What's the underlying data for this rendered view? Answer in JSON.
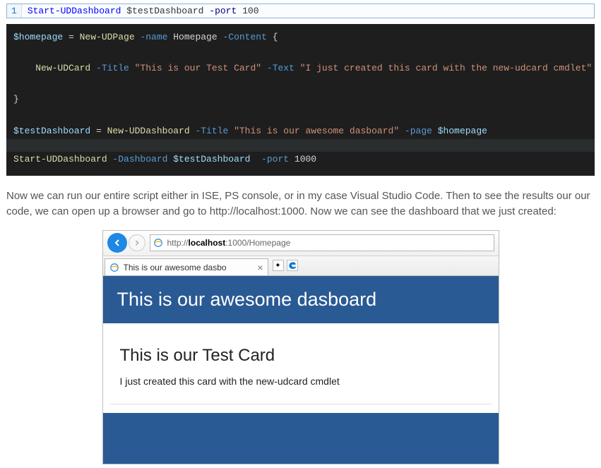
{
  "single_line": {
    "ln": "1",
    "cmd": "Start-UDDashboard",
    "var": "$testDashboard",
    "param": "-port",
    "num": "100"
  },
  "dark": {
    "l1": {
      "var": "$homepage",
      "op1": " = ",
      "cmd": "New-UDPage",
      "p1": " -name ",
      "a1": "Homepage",
      "p2": " -Content ",
      "brace": "{"
    },
    "l2": {
      "cmd": "New-UDCard",
      "p1": " -Title ",
      "s1": "\"This is our Test Card\"",
      "p2": " -Text ",
      "s2": "\"I just created this card with the new-udcard cmdlet\""
    },
    "l3": {
      "brace": "}"
    },
    "l4": {
      "var": "$testDashboard",
      "op": " = ",
      "cmd": "New-UDDashboard",
      "p1": " -Title ",
      "s1": "\"This is our awesome dasboard\"",
      "p2": " -page ",
      "var2": "$homepage"
    },
    "l5": {
      "cmd": "Start-UDDashboard",
      "p1": " -Dashboard ",
      "var": "$testDashboard",
      "p2": "  -port ",
      "num": "1000"
    }
  },
  "prose": "Now we can run our entire script either in ISE, PS console, or in my case Visual Studio Code. Then to see the results our our code, we can open up a browser and go to http://localhost:1000. Now we can see the dashboard that we just created:",
  "browser": {
    "url_prefix": "http://",
    "url_host": "localhost",
    "url_rest": ":1000/Homepage",
    "tab_title": "This is our awesome dasbo",
    "newtab_star": "✦"
  },
  "dashboard": {
    "header": "This is our awesome dasboard",
    "card_title": "This is our Test Card",
    "card_text": "I just created this card with the new-udcard cmdlet"
  }
}
